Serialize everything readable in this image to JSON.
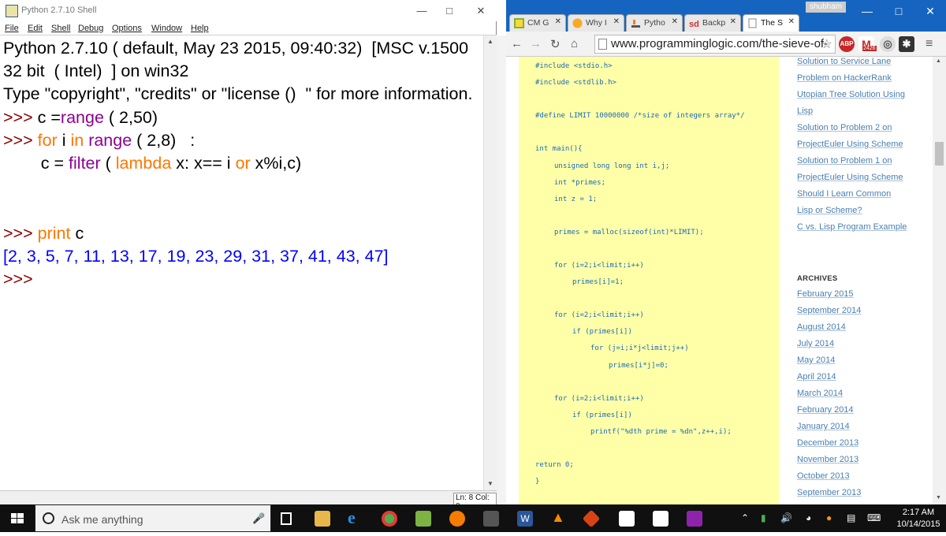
{
  "idle": {
    "title": "Python 2.7.10 Shell",
    "menu": [
      "File",
      "Edit",
      "Shell",
      "Debug",
      "Options",
      "Window",
      "Help"
    ],
    "lines": {
      "banner1": "Python 2.7.10 ( default, May 23 2015, 09:40:32)  [MSC v.1500",
      "banner2": "32 bit  ( Intel)  ] on win32",
      "banner3": "Type \"copyright\", \"credits\" or \"license ()  \" for more information.",
      "prompt": ">>> ",
      "l4_a": "c =",
      "l4_b": "range",
      "l4_c": " ( 2,50)",
      "l5_a": "for",
      "l5_b": " i ",
      "l5_c": "in",
      "l5_d": " ",
      "l5_e": "range",
      "l5_f": " ( 2,8)   :",
      "l6_a": "        c = ",
      "l6_b": "filter",
      "l6_c": " ( ",
      "l6_d": "lambda",
      "l6_e": " x: x== i ",
      "l6_f": "or",
      "l6_g": " x%i,c)",
      "l7_a": "print",
      "l7_b": " c",
      "output": "[2, 3, 5, 7, 11, 13, 17, 19, 23, 29, 31, 37, 41, 43, 47]",
      "last_prompt": ">>>"
    },
    "status": "Ln: 8 Col: 0"
  },
  "chrome": {
    "user": "shubham",
    "tabs": [
      {
        "label": "CM G",
        "active": false
      },
      {
        "label": "Why I",
        "active": false
      },
      {
        "label": "Pytho",
        "active": false
      },
      {
        "label": "Backp",
        "active": false
      },
      {
        "label": "The S",
        "active": true
      }
    ],
    "url": "www.programminglogic.com/the-sieve-of-",
    "extensions": {
      "abp": "ABP",
      "mail_count": "2426"
    },
    "code_lines": [
      "#include <stdio.h>",
      "#include <stdlib.h>",
      "#define LIMIT 10000000 /*size of integers array*/",
      "int main(){",
      "unsigned long long int i,j;",
      "int *primes;",
      "int z = 1;",
      "primes = malloc(sizeof(int)*LIMIT);",
      "for (i=2;i<limit;i++)",
      "primes[i]=1;",
      "for (i=2;i<limit;i++)",
      "if (primes[i])",
      "for (j=i;i*j<limit;j++)",
      "primes[i*j]=0;",
      "for (i=2;i<limit;i++)",
      "if (primes[i])",
      "printf(\"%dth prime = %dn\",z++,i);",
      "return 0;",
      "}"
    ],
    "sidebar_links": [
      "Solution to Service Lane",
      "Problem on HackerRank",
      "Utopian Tree Solution Using",
      "Lisp",
      "Solution to Problem 2 on",
      "ProjectEuler Using Scheme",
      "Solution to Problem 1 on",
      "ProjectEuler Using Scheme",
      "Should I Learn Common",
      "Lisp or Scheme?",
      "C vs. Lisp Program Example"
    ],
    "archives_heading": "ARCHIVES",
    "archives": [
      "February 2015",
      "September 2014",
      "August 2014",
      "July 2014",
      "May 2014",
      "April 2014",
      "March 2014",
      "February 2014",
      "January 2014",
      "December 2013",
      "November 2013",
      "October 2013",
      "September 2013"
    ]
  },
  "taskbar": {
    "search_placeholder": "Ask me anything",
    "time": "2:17 AM",
    "date": "10/14/2015"
  },
  "colors": {
    "keyword": "#ff7700",
    "builtin": "#900090",
    "output": "#0000ff",
    "prompt": "#8b0000",
    "code_bg": "#ffffa8",
    "chrome_frame": "#1565c0"
  }
}
